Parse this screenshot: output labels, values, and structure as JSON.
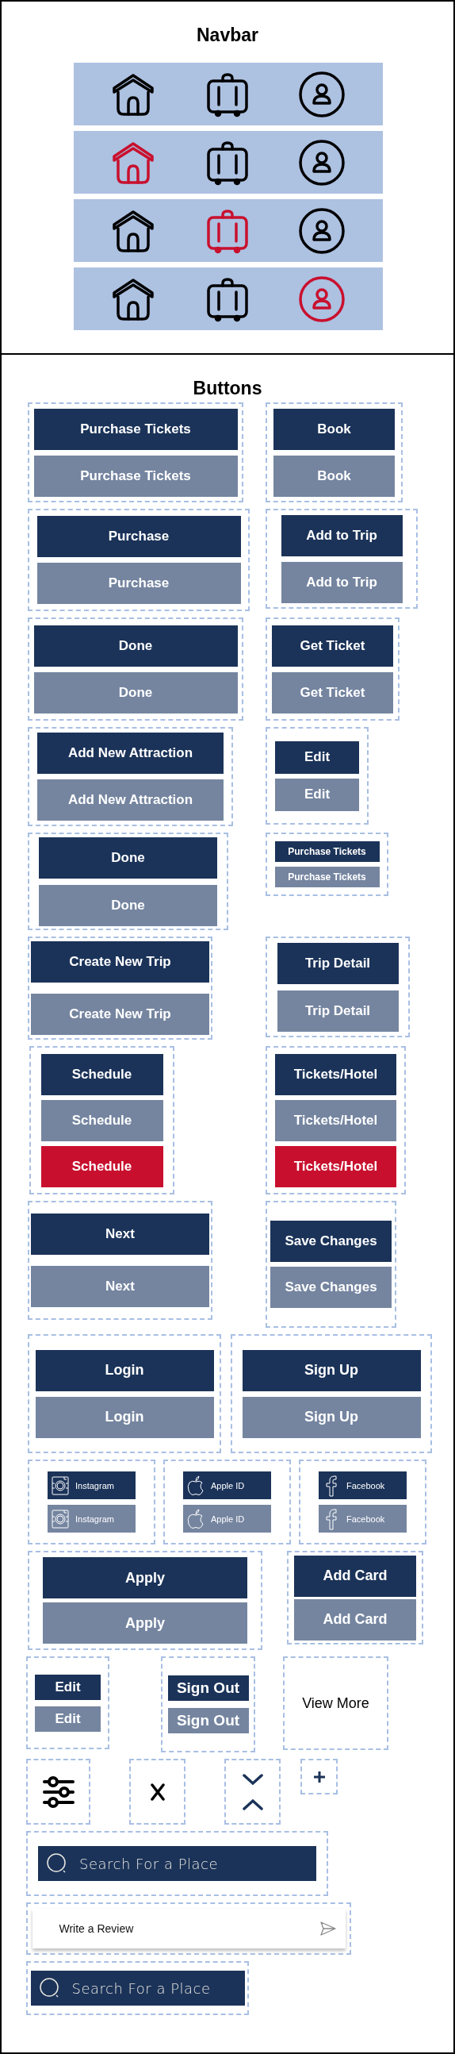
{
  "navbar": {
    "title": "Navbar",
    "bars": [
      {
        "items": [
          {
            "kind": "home",
            "selected": false
          },
          {
            "kind": "luggage",
            "selected": false
          },
          {
            "kind": "profile",
            "selected": false
          }
        ]
      },
      {
        "items": [
          {
            "kind": "home",
            "selected": true
          },
          {
            "kind": "luggage",
            "selected": false
          },
          {
            "kind": "profile",
            "selected": false
          }
        ]
      },
      {
        "items": [
          {
            "kind": "home",
            "selected": false
          },
          {
            "kind": "luggage",
            "selected": true
          },
          {
            "kind": "profile",
            "selected": false
          }
        ]
      },
      {
        "items": [
          {
            "kind": "home",
            "selected": false
          },
          {
            "kind": "luggage",
            "selected": false
          },
          {
            "kind": "profile",
            "selected": true
          }
        ]
      }
    ]
  },
  "buttons_section": {
    "title": "Buttons",
    "rows": [
      {
        "groups": [
          {
            "kind": "text",
            "buttons": [
              {
                "label": "Purchase Tickets",
                "disabled": false,
                "active": false
              },
              {
                "label": "Purchase Tickets",
                "disabled": true,
                "active": false
              }
            ]
          },
          {
            "kind": "text",
            "buttons": [
              {
                "label": "Book",
                "disabled": false,
                "active": false
              },
              {
                "label": "Book",
                "disabled": true,
                "active": false
              }
            ]
          }
        ]
      },
      {
        "groups": [
          {
            "kind": "text",
            "buttons": [
              {
                "label": "Purchase",
                "disabled": false,
                "active": false
              },
              {
                "label": "Purchase",
                "disabled": true,
                "active": false
              }
            ]
          },
          {
            "kind": "text",
            "buttons": [
              {
                "label": "Add to Trip",
                "disabled": false,
                "active": false
              },
              {
                "label": "Add to Trip",
                "disabled": true,
                "active": false
              }
            ]
          }
        ]
      },
      {
        "groups": [
          {
            "kind": "text",
            "buttons": [
              {
                "label": "Done",
                "disabled": false,
                "active": false
              },
              {
                "label": "Done",
                "disabled": true,
                "active": false
              }
            ]
          },
          {
            "kind": "text",
            "buttons": [
              {
                "label": "Get Ticket",
                "disabled": false,
                "active": false
              },
              {
                "label": "Get Ticket",
                "disabled": true,
                "active": false
              }
            ]
          }
        ]
      },
      {
        "groups": [
          {
            "kind": "text",
            "buttons": [
              {
                "label": "Add New Attraction",
                "disabled": false,
                "active": false
              },
              {
                "label": "Add New Attraction",
                "disabled": true,
                "active": false
              }
            ]
          },
          {
            "kind": "text",
            "buttons": [
              {
                "label": "Edit",
                "disabled": false,
                "active": false
              },
              {
                "label": "Edit",
                "disabled": true,
                "active": false
              }
            ]
          }
        ]
      },
      {
        "groups": [
          {
            "kind": "text",
            "buttons": [
              {
                "label": "Done",
                "disabled": false,
                "active": false
              },
              {
                "label": "Done",
                "disabled": true,
                "active": false
              }
            ]
          },
          {
            "kind": "text",
            "buttons": [
              {
                "label": "Purchase Tickets",
                "disabled": false,
                "active": false
              },
              {
                "label": "Purchase Tickets",
                "disabled": true,
                "active": false
              }
            ]
          }
        ]
      },
      {
        "groups": [
          {
            "kind": "text",
            "buttons": [
              {
                "label": "Create New Trip",
                "disabled": false,
                "active": false
              },
              {
                "label": "Create New Trip",
                "disabled": true,
                "active": false
              }
            ]
          },
          {
            "kind": "text",
            "buttons": [
              {
                "label": "Trip Detail",
                "disabled": false,
                "active": false
              },
              {
                "label": "Trip Detail",
                "disabled": true,
                "active": false
              }
            ]
          }
        ]
      },
      {
        "groups": [
          {
            "kind": "text",
            "buttons": [
              {
                "label": "Schedule",
                "disabled": false,
                "active": false
              },
              {
                "label": "Schedule",
                "disabled": true,
                "active": false
              },
              {
                "label": "Schedule",
                "disabled": false,
                "active": true
              }
            ]
          },
          {
            "kind": "text",
            "buttons": [
              {
                "label": "Tickets/Hotel",
                "disabled": false,
                "active": false
              },
              {
                "label": "Tickets/Hotel",
                "disabled": true,
                "active": false
              },
              {
                "label": "Tickets/Hotel",
                "disabled": false,
                "active": true
              }
            ]
          }
        ]
      },
      {
        "groups": [
          {
            "kind": "text",
            "buttons": [
              {
                "label": "Next",
                "disabled": false,
                "active": false
              },
              {
                "label": "Next",
                "disabled": true,
                "active": false
              }
            ]
          },
          {
            "kind": "text",
            "buttons": [
              {
                "label": "Save Changes",
                "disabled": false,
                "active": false
              },
              {
                "label": "Save Changes",
                "disabled": true,
                "active": false
              }
            ]
          }
        ]
      },
      {
        "groups": [
          {
            "kind": "text",
            "buttons": [
              {
                "label": "Login",
                "disabled": false,
                "active": false
              },
              {
                "label": "Login",
                "disabled": true,
                "active": false
              }
            ]
          },
          {
            "kind": "text",
            "buttons": [
              {
                "label": "Sign Up",
                "disabled": false,
                "active": false
              },
              {
                "label": "Sign Up",
                "disabled": true,
                "active": false
              }
            ]
          }
        ]
      },
      {
        "groups": [
          {
            "kind": "social",
            "buttons": [
              {
                "kind": "camera",
                "label": "Instagram",
                "disabled": false,
                "active": false
              },
              {
                "kind": "camera",
                "label": "Instagram",
                "disabled": true,
                "active": false
              }
            ]
          },
          {
            "kind": "social",
            "buttons": [
              {
                "kind": "apple",
                "label": "Apple ID",
                "disabled": false,
                "active": false
              },
              {
                "kind": "apple",
                "label": "Apple ID",
                "disabled": true,
                "active": false
              }
            ]
          },
          {
            "kind": "social",
            "buttons": [
              {
                "kind": "facebook",
                "label": "Facebook",
                "disabled": false,
                "active": false
              },
              {
                "kind": "facebook",
                "label": "Facebook",
                "disabled": true,
                "active": false
              }
            ]
          }
        ]
      },
      {
        "groups": [
          {
            "kind": "text",
            "buttons": [
              {
                "label": "Apply",
                "disabled": false,
                "active": false
              },
              {
                "label": "Apply",
                "disabled": true,
                "active": false
              }
            ]
          },
          {
            "kind": "text",
            "buttons": [
              {
                "label": "Add Card",
                "disabled": false,
                "active": false
              },
              {
                "label": "Add Card",
                "disabled": true,
                "active": false
              }
            ]
          }
        ]
      },
      {
        "groups": [
          {
            "kind": "text",
            "buttons": [
              {
                "label": "Edit",
                "disabled": false,
                "active": false
              },
              {
                "label": "Edit",
                "disabled": true,
                "active": false
              }
            ]
          },
          {
            "kind": "text",
            "buttons": [
              {
                "label": "Sign Out",
                "disabled": false,
                "active": false
              },
              {
                "label": "Sign Out",
                "disabled": true,
                "active": false
              }
            ]
          },
          {
            "kind": "link",
            "label": "View More"
          }
        ]
      },
      {
        "groups": [
          {
            "kind": "sliders"
          },
          {
            "kind": "close"
          },
          {
            "kind": "chevrons"
          },
          {
            "kind": "plus"
          }
        ]
      },
      {
        "groups": [
          {
            "kind": "search",
            "placeholder": "Search For a Place"
          }
        ]
      },
      {
        "groups": [
          {
            "kind": "review",
            "placeholder": "Write a Review"
          }
        ]
      },
      {
        "groups": [
          {
            "kind": "search",
            "placeholder": "Search For a Place"
          }
        ]
      }
    ]
  }
}
